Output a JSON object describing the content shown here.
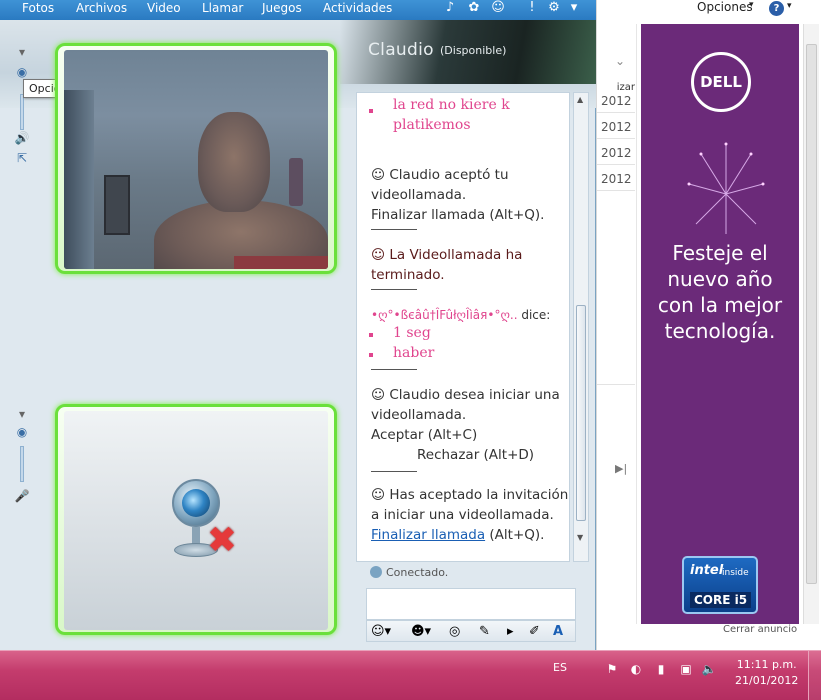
{
  "menu": {
    "items": [
      "Fotos",
      "Archivos",
      "Video",
      "Llamar",
      "Juegos",
      "Actividades"
    ],
    "icons": [
      "games-icon",
      "activities-icon",
      "emoticon-icon",
      "notification-icon",
      "help-icon",
      "dropdown-icon"
    ]
  },
  "contact": {
    "name": "Claudio",
    "status": "(Disponible)"
  },
  "tooltip": "Opciones para esta persona",
  "conversation": {
    "top_fragment": [
      "la red no kiere k",
      "platikemos"
    ],
    "msg1": [
      "Claudio aceptó tu",
      "videollamada.",
      "Finalizar llamada (Alt+Q)."
    ],
    "msg2": [
      "La Videollamada ha",
      "terminado."
    ],
    "sender": "•ღ°•ßєâû†ÎFûłღÎìâя•°ღ..",
    "sender_says": "dice:",
    "sent_lines": [
      "1 seg",
      "haber"
    ],
    "msg3": [
      "Claudio desea iniciar una",
      "videollamada.",
      "Aceptar (Alt+C)",
      "Rechazar (Alt+D)"
    ],
    "msg4": [
      "Has aceptado la invitación",
      "a iniciar una videollamada."
    ],
    "msg4_link": "Finalizar llamada",
    "msg4_tail": "(Alt+Q).",
    "connected": "Conectado."
  },
  "background_window": {
    "opciones": "Opciones",
    "column_header": "izar",
    "dates": [
      "2012",
      "2012",
      "2012",
      "2012"
    ],
    "ad": {
      "brand": "DELL",
      "lines": [
        "Festeje el",
        "nuevo año",
        "con la mejor",
        "tecnología."
      ],
      "intel_1": "intel",
      "intel_2": "inside",
      "intel_3": "CORE i5",
      "close": "Cerrar anuncio"
    }
  },
  "taskbar": {
    "language": "ES",
    "time": "11:11 p.m.",
    "date": "21/01/2012"
  },
  "colors": {
    "menubar": "#2f84cb",
    "video_glow": "#6be03b",
    "pink_text": "#e0458e",
    "taskbar": "#c43c6d",
    "ad_purple": "#6b2a79"
  }
}
